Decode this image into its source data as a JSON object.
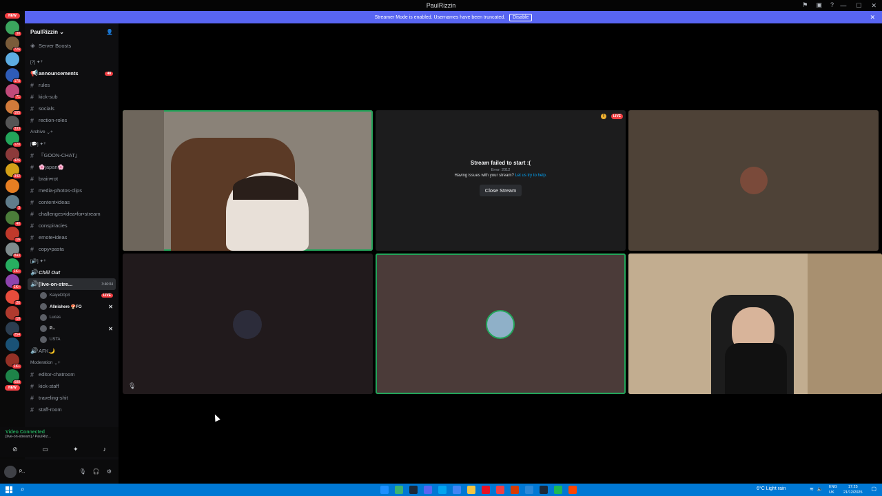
{
  "window": {
    "title": "PaulRizzin"
  },
  "banner": {
    "text": "Streamer Mode is enabled. Usernames have been truncated.",
    "disable_label": "Disable"
  },
  "rail": {
    "new_label": "NEW",
    "servers": [
      {
        "color": "#3ba55d",
        "badge": "30"
      },
      {
        "color": "#7a5c3a",
        "badge": "726"
      },
      {
        "color": "#5dade2",
        "badge": ""
      },
      {
        "color": "#2e5cb8",
        "badge": "170"
      },
      {
        "color": "#c04a7a",
        "badge": "71"
      },
      {
        "color": "#d17a3a",
        "badge": "165"
      },
      {
        "color": "#555",
        "badge": "333"
      },
      {
        "color": "#23a55a",
        "badge": "120"
      },
      {
        "color": "#8c3a3a",
        "badge": "426"
      },
      {
        "color": "#d4a017",
        "badge": "342"
      },
      {
        "color": "#e67e22",
        "badge": ""
      },
      {
        "color": "#607d8b",
        "badge": "3"
      },
      {
        "color": "#4b7d3a",
        "badge": "40"
      },
      {
        "color": "#c0392b",
        "badge": "16"
      },
      {
        "color": "#7f8c8d",
        "badge": "843"
      },
      {
        "color": "#27ae60",
        "badge": "1K+"
      },
      {
        "color": "#8e44ad",
        "badge": "1K+"
      },
      {
        "color": "#e74c3c",
        "badge": "26"
      },
      {
        "color": "#b03a2e",
        "badge": "10"
      },
      {
        "color": "#2c3e50",
        "badge": "254"
      },
      {
        "color": "#1a5276",
        "badge": ""
      },
      {
        "color": "#943126",
        "badge": "1K+"
      },
      {
        "color": "#1e8449",
        "badge": "688"
      }
    ]
  },
  "sidebar": {
    "server_name": "PaulRizzin",
    "boosts": "Server Boosts",
    "cat1": "[?] ✦",
    "announcements": "announcements",
    "announcements_count": "48",
    "channels1": [
      "rules",
      "kick-sub",
      "socials",
      "rection-roles"
    ],
    "cat_archive": "Archive",
    "cat2": "[💬] ✦",
    "channels2": [
      "『GOON-CHAT』",
      "🌸japan🌸",
      "brain•rot",
      "media-photos-clips",
      "content•ideas",
      "challenges•idea•for•stream",
      "conspiracies",
      "emote•ideas",
      "copy•pasta"
    ],
    "cat3": "[🔊] ✦",
    "chill_out": "Chill Out",
    "live_channel": "[live-on-stre...",
    "live_timer": "3:46:04",
    "voice_users": [
      {
        "name": "KaiyeD0p3",
        "tag": "LIVE",
        "bold": false
      },
      {
        "name": "Allnishere 🍄FO",
        "tag": "✕",
        "bold": true
      },
      {
        "name": "Lucas",
        "tag": "",
        "bold": false
      },
      {
        "name": "P...",
        "tag": "✕",
        "bold": true
      },
      {
        "name": "USTA",
        "tag": "",
        "bold": false
      }
    ],
    "afk": "AFK🌙",
    "cat_moderation": "Moderation",
    "channels3": [
      "editor-chatroom",
      "kick-staff",
      "traveling-shit",
      "staff-room"
    ]
  },
  "voice_panel": {
    "status": "Video Connected",
    "channel": "[live-on-stream] / PaulRiz..."
  },
  "user_panel": {
    "name": "P..."
  },
  "stream": {
    "fail_title": "Stream failed to start :(",
    "error": "Error: 2012",
    "question": "Having issues with your stream?",
    "help_link": "Let us try to help.",
    "close_label": "Close Stream",
    "live": "LIVE"
  },
  "taskbar": {
    "weather": "6°C Light rain",
    "lang1": "ENG",
    "lang2": "UK",
    "time": "17:25",
    "date": "21/12/2025",
    "apps": [
      "#1e90ff",
      "#3cb371",
      "#1b2838",
      "#5865f2",
      "#00a4ef",
      "#4285f4",
      "#f4c542",
      "#e81123",
      "#f23f43",
      "#d83b01",
      "#2b88d8",
      "#1b2838",
      "#1db954",
      "#ff4500"
    ]
  }
}
